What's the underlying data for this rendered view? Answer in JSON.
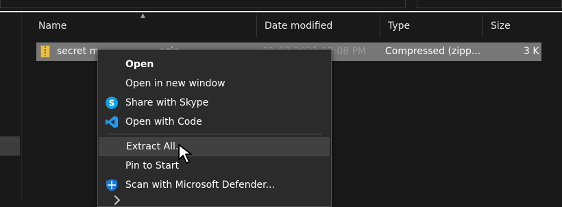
{
  "columns": {
    "name": "Name",
    "date_modified": "Date modified",
    "type": "Type",
    "size": "Size"
  },
  "file": {
    "name_visible": "secret m",
    "name_tail": "r.zip",
    "date_partial": "01-07-2021 02:08 PM",
    "type": "Compressed (zipp...",
    "size": "3 K"
  },
  "context_menu": {
    "items": [
      {
        "label": "Open",
        "bold": true,
        "icon": ""
      },
      {
        "label": "Open in new window",
        "icon": ""
      },
      {
        "label": "Share with Skype",
        "icon": "skype-icon"
      },
      {
        "label": "Open with Code",
        "icon": "vscode-icon"
      },
      {
        "label": "Extract All...",
        "icon": "",
        "highlighted": true
      },
      {
        "label": "Pin to Start",
        "icon": ""
      },
      {
        "label": "Scan with Microsoft Defender...",
        "icon": "defender-shield-icon"
      }
    ]
  },
  "colors": {
    "background": "#191919",
    "menu_bg": "#2b2b2b",
    "selected_row": "#777777",
    "menu_highlight": "#414141",
    "skype_blue": "#0ea1e9",
    "vscode_blue": "#1f9cf0",
    "defender_blue": "#1c78d4"
  }
}
